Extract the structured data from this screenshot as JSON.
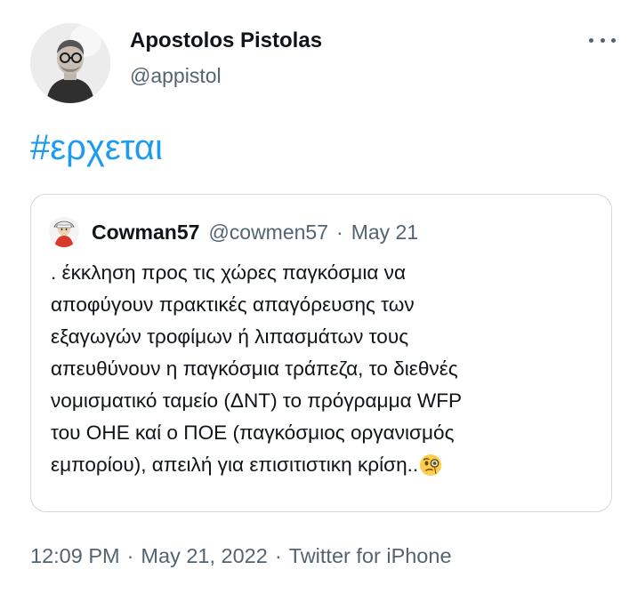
{
  "author": {
    "display_name": "Apostolos Pistolas",
    "handle": "@appistol"
  },
  "tweet": {
    "hashtag": "#ερχεται"
  },
  "quoted_tweet": {
    "display_name": "Cowman57",
    "handle": "@cowmen57",
    "separator": "·",
    "date": "May 21",
    "lines": [
      ". έκκληση προς τις χώρες παγκόσμια να",
      "αποφύγουν πρακτικές απαγόρευσης των",
      "εξαγωγών τροφίμων ή λιπασμάτων τους",
      "απευθύνουν η παγκόσμια τράπεζα, το διεθνές",
      "νομισματικό ταμείο (ΔΝΤ) το πρόγραμμα WFP",
      "του ΟΗΕ καί ο ΠΟΕ (παγκόσμιος οργανισμός",
      "εμπορίου), απειλή για επισιτιστικη κρίση.."
    ],
    "emoji": "face-with-monocle"
  },
  "meta": {
    "time": "12:09 PM",
    "separator": "·",
    "date": "May 21, 2022",
    "source": "Twitter for iPhone"
  },
  "colors": {
    "link": "#1d9bf0",
    "secondary_text": "#536471",
    "border": "#cfd9de"
  },
  "icons": {
    "more": "more-horizontal-icon"
  }
}
